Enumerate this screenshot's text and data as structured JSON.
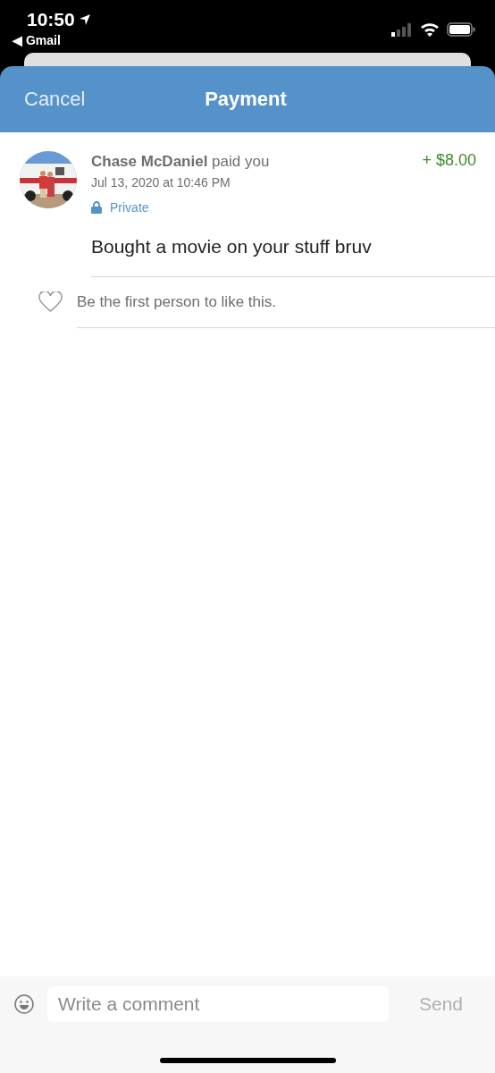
{
  "status_bar": {
    "time": "10:50",
    "back_app": "◀ Gmail"
  },
  "header": {
    "cancel": "Cancel",
    "title": "Payment"
  },
  "payment": {
    "summary": "**Chase McDaniel** paid you",
    "date": "Jul 13, 2020 at 10:46 PM",
    "visibility": "Private",
    "amount": "+ $8.00",
    "note": "Bought a movie on your stuff bruv"
  },
  "likes": {
    "liked": false,
    "text": "Be the first person to like this."
  },
  "comment_bar": {
    "placeholder": "Write a comment",
    "send": "Send",
    "send_disabled": true
  }
}
